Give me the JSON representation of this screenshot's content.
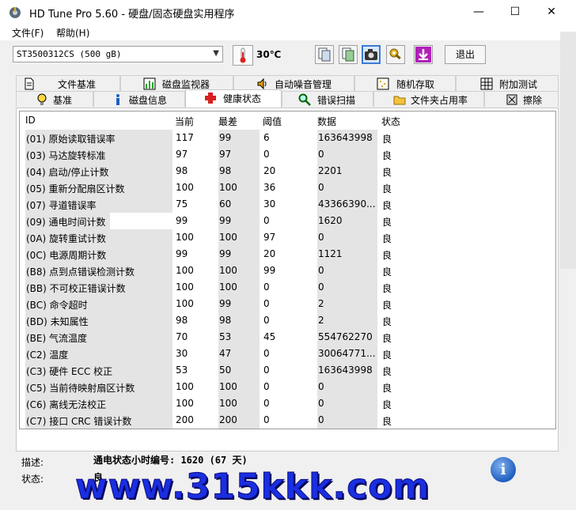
{
  "window": {
    "title": "HD Tune Pro 5.60 - 硬盘/固态硬盘实用程序",
    "minimize": "—",
    "maximize": "☐",
    "close": "✕"
  },
  "menu": {
    "file": "文件(F)",
    "help": "帮助(H)"
  },
  "toolbar": {
    "drive": "ST3500312CS (500 gB)",
    "temperature": "30℃",
    "exit": "退出"
  },
  "tabs_top": [
    "文件基准",
    "磁盘监视器",
    "自动噪音管理",
    "随机存取",
    "附加测试"
  ],
  "tabs_bottom": [
    "基准",
    "磁盘信息",
    "健康状态",
    "错误扫描",
    "文件夹占用率",
    "擦除"
  ],
  "table": {
    "columns": [
      "ID",
      "当前",
      "最差",
      "阈值",
      "数据",
      "状态"
    ],
    "rows": [
      [
        "(01) 原始读取错误率",
        "117",
        "99",
        "6",
        "163643998",
        "良"
      ],
      [
        "(03) 马达旋转标准",
        "97",
        "97",
        "0",
        "0",
        "良"
      ],
      [
        "(04) 启动/停止计数",
        "98",
        "98",
        "20",
        "2201",
        "良"
      ],
      [
        "(05) 重新分配扇区计数",
        "100",
        "100",
        "36",
        "0",
        "良"
      ],
      [
        "(07) 寻道错误率",
        "75",
        "60",
        "30",
        "43366390...",
        "良"
      ],
      [
        "(09) 通电时间计数",
        "99",
        "99",
        "0",
        "1620",
        "良"
      ],
      [
        "(0A) 旋转重试计数",
        "100",
        "100",
        "97",
        "0",
        "良"
      ],
      [
        "(0C) 电源周期计数",
        "99",
        "99",
        "20",
        "1121",
        "良"
      ],
      [
        "(B8) 点到点错误检测计数",
        "100",
        "100",
        "99",
        "0",
        "良"
      ],
      [
        "(BB) 不可校正错误计数",
        "100",
        "100",
        "0",
        "0",
        "良"
      ],
      [
        "(BC) 命令超时",
        "100",
        "99",
        "0",
        "2",
        "良"
      ],
      [
        "(BD) 未知属性",
        "98",
        "98",
        "0",
        "2",
        "良"
      ],
      [
        "(BE) 气流温度",
        "70",
        "53",
        "45",
        "554762270",
        "良"
      ],
      [
        "(C2) 温度",
        "30",
        "47",
        "0",
        "30064771...",
        "良"
      ],
      [
        "(C3) 硬件 ECC 校正",
        "53",
        "50",
        "0",
        "163643998",
        "良"
      ],
      [
        "(C5) 当前待映射扇区计数",
        "100",
        "100",
        "0",
        "0",
        "良"
      ],
      [
        "(C6) 离线无法校正",
        "100",
        "100",
        "0",
        "0",
        "良"
      ],
      [
        "(C7) 接口 CRC 错误计数",
        "200",
        "200",
        "0",
        "0",
        "良"
      ]
    ]
  },
  "details": {
    "desc_label": "描述:",
    "desc_value": "通电状态小时编号: 1620 (67 天)",
    "status_label": "状态:",
    "status_value": "良"
  },
  "info_glyph": "i",
  "watermark": "www.315kkk.com",
  "colors": {
    "accent": "#3a7bd5",
    "shade": "#e4e4e4",
    "watermark": "#1a2fe0"
  }
}
